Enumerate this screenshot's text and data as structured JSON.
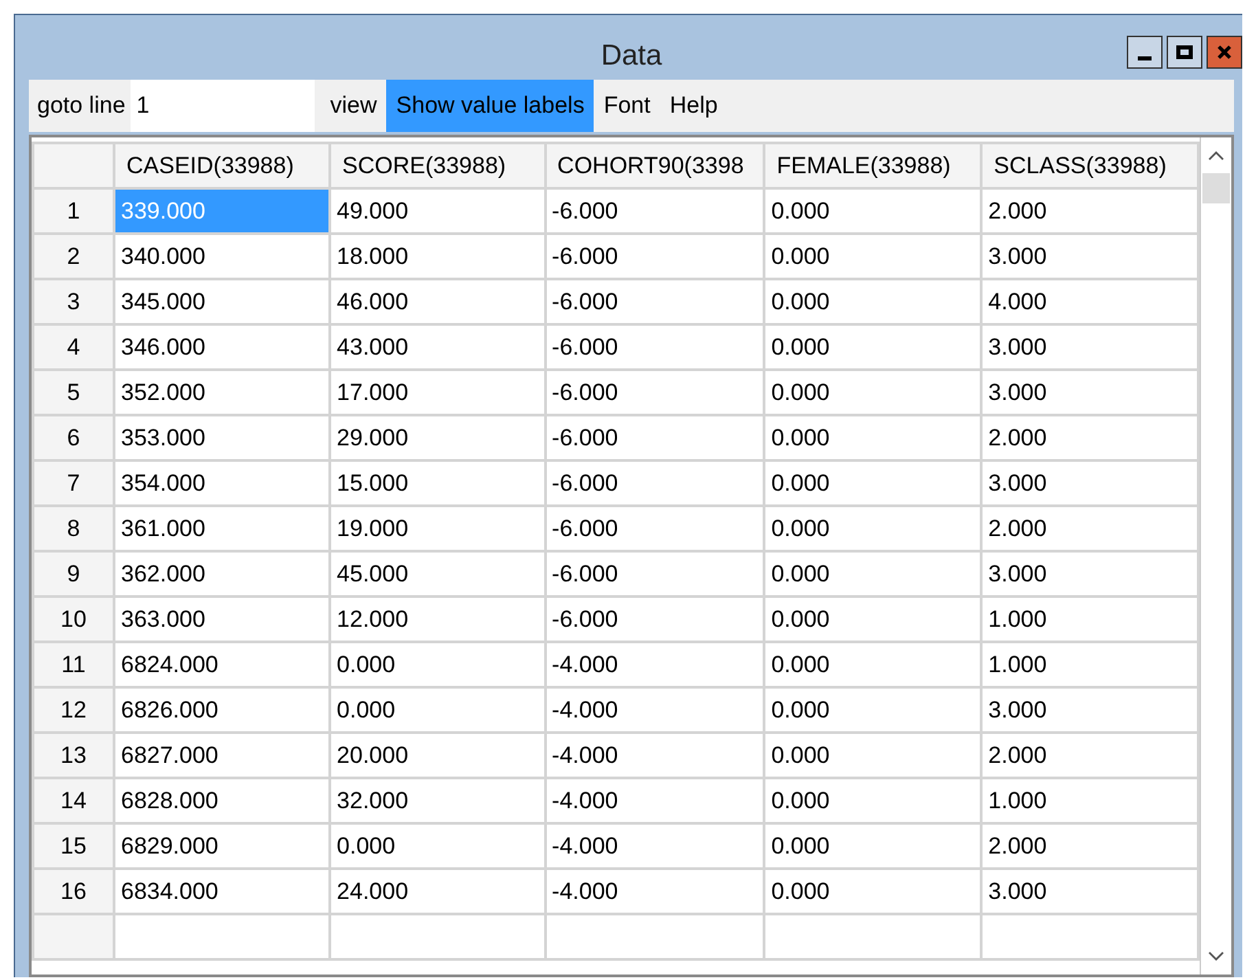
{
  "window": {
    "title": "Data"
  },
  "toolbar": {
    "goto_label": "goto line",
    "goto_value": "1"
  },
  "menu": [
    {
      "label": "view",
      "selected": false
    },
    {
      "label": "Show value labels",
      "selected": true
    },
    {
      "label": "Font",
      "selected": false
    },
    {
      "label": "Help",
      "selected": false
    }
  ],
  "table": {
    "columns": [
      "CASEID(33988)",
      "SCORE(33988)",
      "COHORT90(3398",
      "FEMALE(33988)",
      "SCLASS(33988)"
    ],
    "rows": [
      {
        "number": "1",
        "cells": [
          {
            "text": "339.000",
            "selected": true
          },
          {
            "text": "49.000",
            "selected": false
          },
          {
            "text": "-6.000",
            "selected": false
          },
          {
            "text": "0.000",
            "selected": false
          },
          {
            "text": "2.000",
            "selected": false
          }
        ]
      },
      {
        "number": "2",
        "cells": [
          {
            "text": "340.000",
            "selected": false
          },
          {
            "text": "18.000",
            "selected": false
          },
          {
            "text": "-6.000",
            "selected": false
          },
          {
            "text": "0.000",
            "selected": false
          },
          {
            "text": "3.000",
            "selected": false
          }
        ]
      },
      {
        "number": "3",
        "cells": [
          {
            "text": "345.000",
            "selected": false
          },
          {
            "text": "46.000",
            "selected": false
          },
          {
            "text": "-6.000",
            "selected": false
          },
          {
            "text": "0.000",
            "selected": false
          },
          {
            "text": "4.000",
            "selected": false
          }
        ]
      },
      {
        "number": "4",
        "cells": [
          {
            "text": "346.000",
            "selected": false
          },
          {
            "text": "43.000",
            "selected": false
          },
          {
            "text": "-6.000",
            "selected": false
          },
          {
            "text": "0.000",
            "selected": false
          },
          {
            "text": "3.000",
            "selected": false
          }
        ]
      },
      {
        "number": "5",
        "cells": [
          {
            "text": "352.000",
            "selected": false
          },
          {
            "text": "17.000",
            "selected": false
          },
          {
            "text": "-6.000",
            "selected": false
          },
          {
            "text": "0.000",
            "selected": false
          },
          {
            "text": "3.000",
            "selected": false
          }
        ]
      },
      {
        "number": "6",
        "cells": [
          {
            "text": "353.000",
            "selected": false
          },
          {
            "text": "29.000",
            "selected": false
          },
          {
            "text": "-6.000",
            "selected": false
          },
          {
            "text": "0.000",
            "selected": false
          },
          {
            "text": "2.000",
            "selected": false
          }
        ]
      },
      {
        "number": "7",
        "cells": [
          {
            "text": "354.000",
            "selected": false
          },
          {
            "text": "15.000",
            "selected": false
          },
          {
            "text": "-6.000",
            "selected": false
          },
          {
            "text": "0.000",
            "selected": false
          },
          {
            "text": "3.000",
            "selected": false
          }
        ]
      },
      {
        "number": "8",
        "cells": [
          {
            "text": "361.000",
            "selected": false
          },
          {
            "text": "19.000",
            "selected": false
          },
          {
            "text": "-6.000",
            "selected": false
          },
          {
            "text": "0.000",
            "selected": false
          },
          {
            "text": "2.000",
            "selected": false
          }
        ]
      },
      {
        "number": "9",
        "cells": [
          {
            "text": "362.000",
            "selected": false
          },
          {
            "text": "45.000",
            "selected": false
          },
          {
            "text": "-6.000",
            "selected": false
          },
          {
            "text": "0.000",
            "selected": false
          },
          {
            "text": "3.000",
            "selected": false
          }
        ]
      },
      {
        "number": "10",
        "cells": [
          {
            "text": "363.000",
            "selected": false
          },
          {
            "text": "12.000",
            "selected": false
          },
          {
            "text": "-6.000",
            "selected": false
          },
          {
            "text": "0.000",
            "selected": false
          },
          {
            "text": "1.000",
            "selected": false
          }
        ]
      },
      {
        "number": "11",
        "cells": [
          {
            "text": "6824.000",
            "selected": false
          },
          {
            "text": "0.000",
            "selected": false
          },
          {
            "text": "-4.000",
            "selected": false
          },
          {
            "text": "0.000",
            "selected": false
          },
          {
            "text": "1.000",
            "selected": false
          }
        ]
      },
      {
        "number": "12",
        "cells": [
          {
            "text": "6826.000",
            "selected": false
          },
          {
            "text": "0.000",
            "selected": false
          },
          {
            "text": "-4.000",
            "selected": false
          },
          {
            "text": "0.000",
            "selected": false
          },
          {
            "text": "3.000",
            "selected": false
          }
        ]
      },
      {
        "number": "13",
        "cells": [
          {
            "text": "6827.000",
            "selected": false
          },
          {
            "text": "20.000",
            "selected": false
          },
          {
            "text": "-4.000",
            "selected": false
          },
          {
            "text": "0.000",
            "selected": false
          },
          {
            "text": "2.000",
            "selected": false
          }
        ]
      },
      {
        "number": "14",
        "cells": [
          {
            "text": "6828.000",
            "selected": false
          },
          {
            "text": "32.000",
            "selected": false
          },
          {
            "text": "-4.000",
            "selected": false
          },
          {
            "text": "0.000",
            "selected": false
          },
          {
            "text": "1.000",
            "selected": false
          }
        ]
      },
      {
        "number": "15",
        "cells": [
          {
            "text": "6829.000",
            "selected": false
          },
          {
            "text": "0.000",
            "selected": false
          },
          {
            "text": "-4.000",
            "selected": false
          },
          {
            "text": "0.000",
            "selected": false
          },
          {
            "text": "2.000",
            "selected": false
          }
        ]
      },
      {
        "number": "16",
        "cells": [
          {
            "text": "6834.000",
            "selected": false
          },
          {
            "text": "24.000",
            "selected": false
          },
          {
            "text": "-4.000",
            "selected": false
          },
          {
            "text": "0.000",
            "selected": false
          },
          {
            "text": "3.000",
            "selected": false
          }
        ]
      }
    ]
  }
}
